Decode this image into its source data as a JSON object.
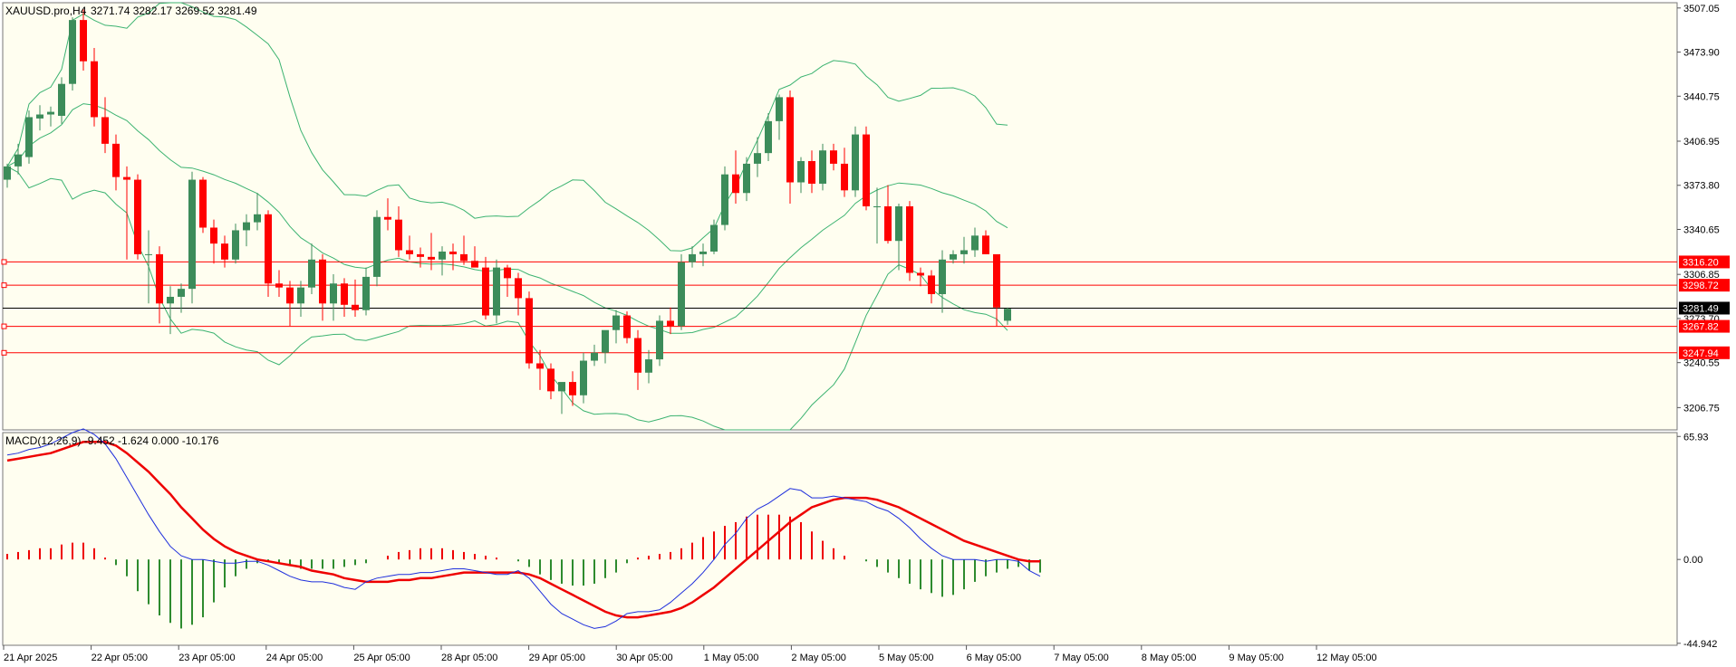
{
  "title": "XAUUSD.pro,H4",
  "ohlc": "3271.74 3282.17 3269.52 3281.49",
  "macd_label": "MACD(12,26,9) -9.452 -1.624 0.000 -10.176",
  "colors": {
    "background": "#fffef0",
    "bull": "#3c8c5a",
    "bear": "#ff0000",
    "band": "#3cb371",
    "macd_signal": "#ee0000",
    "macd_line": "#1f2fdc"
  },
  "chart_data": [
    {
      "type": "candlestick",
      "title": "XAUUSD.pro,H4",
      "ylim": [
        3190.0,
        3511.0
      ],
      "y_ticks": [
        "3507.05",
        "3473.90",
        "3440.75",
        "3406.95",
        "3373.80",
        "3340.65",
        "3306.85",
        "3273.70",
        "3240.55",
        "3206.75"
      ],
      "x_ticks": [
        "21 Apr 2025",
        "22 Apr 05:00",
        "23 Apr 05:00",
        "24 Apr 05:00",
        "25 Apr 05:00",
        "28 Apr 05:00",
        "29 Apr 05:00",
        "30 Apr 05:00",
        "1 May 05:00",
        "2 May 05:00",
        "5 May 05:00",
        "6 May 05:00",
        "7 May 05:00",
        "8 May 05:00",
        "9 May 05:00",
        "12 May 05:00"
      ],
      "levels": [
        {
          "label": "3316.20",
          "value": 3316.2,
          "color": "#ff0000"
        },
        {
          "label": "3298.72",
          "value": 3298.72,
          "color": "#ff0000"
        },
        {
          "label": "3281.49",
          "value": 3281.49,
          "color": "#000000"
        },
        {
          "label": "3267.82",
          "value": 3267.82,
          "color": "#ff0000"
        },
        {
          "label": "3247.94",
          "value": 3247.94,
          "color": "#ff0000"
        }
      ],
      "candles": [
        [
          3378,
          3390,
          3372,
          3388
        ],
        [
          3388,
          3405,
          3382,
          3397
        ],
        [
          3395,
          3430,
          3390,
          3425
        ],
        [
          3424,
          3434,
          3415,
          3427
        ],
        [
          3427,
          3433,
          3418,
          3429
        ],
        [
          3426,
          3455,
          3420,
          3450
        ],
        [
          3450,
          3500,
          3445,
          3498
        ],
        [
          3498,
          3506,
          3460,
          3467
        ],
        [
          3467,
          3477,
          3418,
          3425
        ],
        [
          3425,
          3440,
          3398,
          3405
        ],
        [
          3405,
          3412,
          3370,
          3380
        ],
        [
          3380,
          3388,
          3318,
          3378
        ],
        [
          3378,
          3382,
          3318,
          3322
        ],
        [
          3322,
          3340,
          3285,
          3322
        ],
        [
          3322,
          3328,
          3270,
          3285
        ],
        [
          3285,
          3298,
          3262,
          3290
        ],
        [
          3290,
          3300,
          3278,
          3296
        ],
        [
          3296,
          3384,
          3285,
          3378
        ],
        [
          3378,
          3380,
          3338,
          3342
        ],
        [
          3342,
          3348,
          3315,
          3330
        ],
        [
          3330,
          3336,
          3312,
          3318
        ],
        [
          3318,
          3345,
          3315,
          3340
        ],
        [
          3340,
          3352,
          3328,
          3346
        ],
        [
          3346,
          3368,
          3340,
          3352
        ],
        [
          3352,
          3355,
          3290,
          3300
        ],
        [
          3300,
          3310,
          3290,
          3297
        ],
        [
          3297,
          3302,
          3268,
          3285
        ],
        [
          3285,
          3302,
          3275,
          3297
        ],
        [
          3297,
          3330,
          3292,
          3318
        ],
        [
          3318,
          3322,
          3272,
          3285
        ],
        [
          3285,
          3307,
          3272,
          3300
        ],
        [
          3300,
          3304,
          3275,
          3284
        ],
        [
          3284,
          3303,
          3275,
          3280
        ],
        [
          3280,
          3312,
          3276,
          3305
        ],
        [
          3305,
          3355,
          3298,
          3350
        ],
        [
          3350,
          3364,
          3340,
          3348
        ],
        [
          3348,
          3358,
          3320,
          3325
        ],
        [
          3325,
          3336,
          3318,
          3322
        ],
        [
          3322,
          3327,
          3312,
          3320
        ],
        [
          3320,
          3338,
          3310,
          3318
        ],
        [
          3318,
          3328,
          3306,
          3324
        ],
        [
          3324,
          3330,
          3310,
          3322
        ],
        [
          3322,
          3336,
          3314,
          3317
        ],
        [
          3317,
          3328,
          3313,
          3312
        ],
        [
          3312,
          3320,
          3273,
          3276
        ],
        [
          3276,
          3318,
          3270,
          3312
        ],
        [
          3312,
          3314,
          3290,
          3304
        ],
        [
          3304,
          3308,
          3276,
          3289
        ],
        [
          3289,
          3294,
          3236,
          3240
        ],
        [
          3240,
          3250,
          3220,
          3236
        ],
        [
          3236,
          3240,
          3213,
          3219
        ],
        [
          3219,
          3224,
          3202,
          3226
        ],
        [
          3226,
          3234,
          3208,
          3216
        ],
        [
          3216,
          3248,
          3210,
          3242
        ],
        [
          3242,
          3254,
          3238,
          3248
        ],
        [
          3248,
          3262,
          3240,
          3265
        ],
        [
          3265,
          3280,
          3255,
          3276
        ],
        [
          3276,
          3279,
          3255,
          3259
        ],
        [
          3259,
          3265,
          3220,
          3233
        ],
        [
          3233,
          3250,
          3225,
          3243
        ],
        [
          3243,
          3276,
          3238,
          3272
        ],
        [
          3272,
          3282,
          3262,
          3268
        ],
        [
          3268,
          3322,
          3265,
          3316
        ],
        [
          3316,
          3328,
          3312,
          3322
        ],
        [
          3322,
          3330,
          3313,
          3324
        ],
        [
          3324,
          3348,
          3322,
          3344
        ],
        [
          3344,
          3388,
          3340,
          3382
        ],
        [
          3382,
          3400,
          3360,
          3368
        ],
        [
          3368,
          3395,
          3362,
          3390
        ],
        [
          3390,
          3410,
          3380,
          3398
        ],
        [
          3398,
          3428,
          3392,
          3422
        ],
        [
          3422,
          3442,
          3408,
          3440
        ],
        [
          3440,
          3445,
          3360,
          3376
        ],
        [
          3376,
          3395,
          3368,
          3392
        ],
        [
          3392,
          3400,
          3368,
          3375
        ],
        [
          3375,
          3405,
          3370,
          3400
        ],
        [
          3400,
          3405,
          3385,
          3390
        ],
        [
          3390,
          3402,
          3365,
          3370
        ],
        [
          3370,
          3418,
          3365,
          3412
        ],
        [
          3412,
          3418,
          3355,
          3358
        ],
        [
          3358,
          3372,
          3330,
          3358
        ],
        [
          3358,
          3374,
          3330,
          3332
        ],
        [
          3332,
          3360,
          3310,
          3358
        ],
        [
          3358,
          3362,
          3302,
          3308
        ],
        [
          3308,
          3312,
          3298,
          3306
        ],
        [
          3306,
          3310,
          3285,
          3292
        ],
        [
          3292,
          3325,
          3278,
          3318
        ],
        [
          3318,
          3325,
          3315,
          3322
        ],
        [
          3322,
          3335,
          3315,
          3325
        ],
        [
          3325,
          3342,
          3320,
          3336
        ],
        [
          3336,
          3340,
          3322,
          3322
        ],
        [
          3322,
          3302,
          3268,
          3282
        ],
        [
          3272,
          3282,
          3269,
          3281
        ]
      ]
    },
    {
      "type": "macd",
      "title": "MACD(12,26,9) -9.452 -1.624 0.000 -10.176",
      "ylim": [
        -46.0,
        68.0
      ],
      "y_ticks": [
        "65.93",
        "0.00",
        "-44.942"
      ],
      "macd_line": [
        56,
        57,
        59,
        60,
        62,
        65,
        68,
        70,
        67,
        62,
        54,
        44,
        34,
        24,
        15,
        7,
        2,
        0,
        0,
        -1,
        -2,
        -2,
        -1,
        -1,
        -3,
        -6,
        -9,
        -11,
        -12,
        -12,
        -13,
        -15,
        -16,
        -12,
        -10,
        -9,
        -8,
        -8,
        -7,
        -7,
        -6,
        -5,
        -5,
        -6,
        -7,
        -8,
        -8,
        -6,
        -10,
        -17,
        -24,
        -29,
        -32,
        -35,
        -37,
        -36,
        -33,
        -29,
        -28,
        -28,
        -27,
        -23,
        -18,
        -13,
        -7,
        0,
        8,
        14,
        22,
        27,
        30,
        34,
        38,
        37,
        33,
        33,
        34,
        33,
        32,
        31,
        28,
        26,
        22,
        17,
        11,
        6,
        2,
        0,
        0,
        0,
        -1,
        0,
        0,
        -1,
        -6,
        -9
      ],
      "signal_line": [
        53,
        54,
        55,
        56,
        57,
        59,
        61,
        63,
        63,
        63,
        61,
        57,
        52,
        47,
        41,
        35,
        28,
        22,
        16,
        11,
        7,
        4,
        2,
        0,
        -1,
        -2,
        -3,
        -4,
        -6,
        -7,
        -8,
        -10,
        -11,
        -12,
        -12,
        -12,
        -11,
        -11,
        -10,
        -10,
        -9,
        -8,
        -7,
        -7,
        -7,
        -7,
        -7,
        -7,
        -8,
        -10,
        -13,
        -16,
        -19,
        -22,
        -25,
        -28,
        -30,
        -31,
        -31,
        -30,
        -29,
        -28,
        -26,
        -23,
        -19,
        -15,
        -10,
        -5,
        0,
        5,
        10,
        15,
        20,
        24,
        28,
        30,
        32,
        33,
        33,
        33,
        32,
        30,
        28,
        25,
        22,
        19,
        16,
        13,
        10,
        8,
        6,
        4,
        2,
        0,
        -1,
        -1
      ],
      "histogram": [
        3,
        4,
        5,
        6,
        6,
        8,
        9,
        9,
        6,
        1,
        -3,
        -9,
        -17,
        -24,
        -30,
        -34,
        -37,
        -35,
        -31,
        -23,
        -15,
        -9,
        -5,
        -2,
        -1,
        -2,
        -3,
        -5,
        -5,
        -5,
        -5,
        -4,
        -3,
        -2,
        0,
        2,
        4,
        5,
        6,
        6,
        6,
        5,
        4,
        3,
        2,
        1,
        0,
        -1,
        -4,
        -8,
        -11,
        -13,
        -14,
        -14,
        -13,
        -10,
        -7,
        -2,
        1,
        2,
        3,
        4,
        6,
        9,
        12,
        15,
        18,
        20,
        23,
        24,
        24,
        24,
        23,
        20,
        15,
        10,
        6,
        2,
        0,
        -1,
        -4,
        -7,
        -10,
        -13,
        -16,
        -18,
        -20,
        -19,
        -16,
        -12,
        -9,
        -7,
        -5,
        -4,
        -6,
        -7
      ]
    }
  ]
}
